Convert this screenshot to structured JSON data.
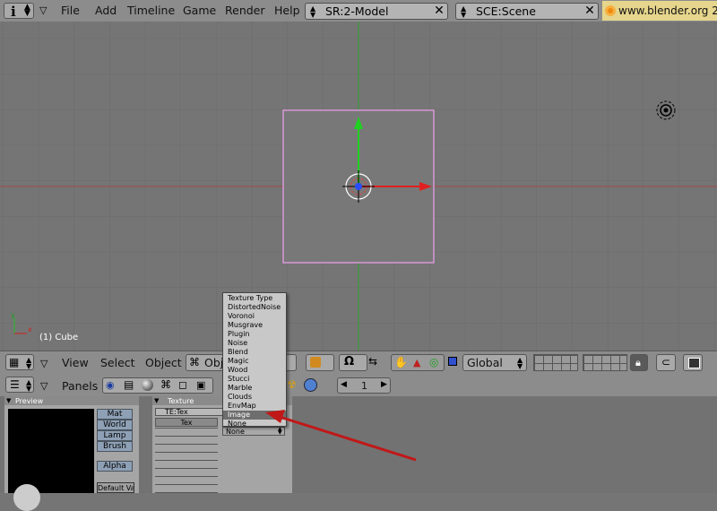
{
  "top_menu": {
    "items": [
      "File",
      "Add",
      "Timeline",
      "Game",
      "Render",
      "Help"
    ],
    "screen_field": "SR:2-Model",
    "scene_field": "SCE:Scene",
    "url": "www.blender.org 2"
  },
  "viewport": {
    "object_label": "(1) Cube"
  },
  "view3d_header": {
    "view_label": "View",
    "select_label": "Select",
    "object_label": "Object",
    "mode_label": "Obj",
    "orientation": "Global"
  },
  "buttons_header": {
    "panels_label": "Panels",
    "frame_number": "1"
  },
  "preview_panel": {
    "title": "Preview",
    "buttons": [
      "Mat",
      "World",
      "Lamp",
      "Brush"
    ],
    "alpha_label": "Alpha",
    "default_label": "Default Va"
  },
  "texture_panel": {
    "title": "Texture",
    "te_field": "TE:Tex",
    "tex_slot": "Tex"
  },
  "texture_type_menu": {
    "header": "Texture Type",
    "items": [
      "DistortedNoise",
      "Voronoi",
      "Musgrave",
      "Plugin",
      "Noise",
      "Blend",
      "Magic",
      "Wood",
      "Stucci",
      "Marble",
      "Clouds",
      "EnvMap",
      "Image",
      "None"
    ],
    "highlighted": "Image",
    "current_value": "None"
  },
  "colors": {
    "viewport_bg": "#757575",
    "header_bg": "#8c8c8c",
    "selection_outline": "#f0a0f0",
    "x_axis": "#d02020",
    "y_axis": "#20c020",
    "annotation_arrow": "#c01818"
  }
}
